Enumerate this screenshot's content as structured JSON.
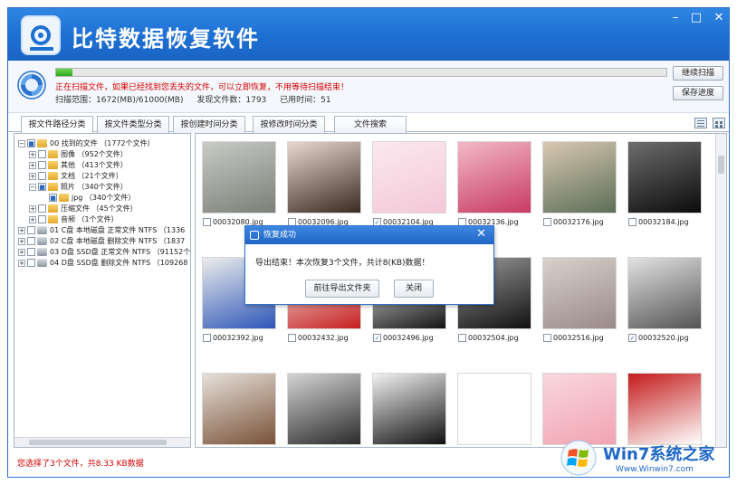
{
  "app": {
    "title": "比特数据恢复软件"
  },
  "window_controls": {
    "minimize": "–",
    "maximize": "□",
    "close": "✕"
  },
  "scan": {
    "progress": 0.027,
    "message": "正在扫描文件，如果已经找到您丢失的文件，可以立即恢复，不用等待扫描结束！",
    "range": "扫描范围：1672(MB)/61000(MB)",
    "found": "发现文件数：1793",
    "elapsed": "已用时间：51",
    "continue_btn": "继续扫描",
    "save_btn": "保存进度"
  },
  "tabs": [
    "按文件路径分类",
    "按文件类型分类",
    "按创建时间分类",
    "按修改时间分类",
    "文件搜索"
  ],
  "tree": [
    {
      "label": "00 找到的文件  （1772个文件）",
      "indent": 0,
      "toggle": "−",
      "checked": "partial",
      "icon": "folder"
    },
    {
      "label": "图像    （952个文件）",
      "indent": 1,
      "toggle": "+",
      "checked": false,
      "icon": "folder"
    },
    {
      "label": "其他    （413个文件）",
      "indent": 1,
      "toggle": "+",
      "checked": false,
      "icon": "folder"
    },
    {
      "label": "文档    （21个文件）",
      "indent": 1,
      "toggle": "+",
      "checked": false,
      "icon": "folder"
    },
    {
      "label": "照片    （340个文件）",
      "indent": 1,
      "toggle": "−",
      "checked": "partial",
      "icon": "folder"
    },
    {
      "label": "jpg   （340个文件）",
      "indent": 2,
      "toggle": "",
      "checked": "partial",
      "icon": "folder"
    },
    {
      "label": "压缩文件   （45个文件）",
      "indent": 1,
      "toggle": "+",
      "checked": false,
      "icon": "folder"
    },
    {
      "label": "音频    （1个文件）",
      "indent": 1,
      "toggle": "+",
      "checked": false,
      "icon": "folder"
    },
    {
      "label": "01 C盘 本地磁盘 正常文件 NTFS  （1336",
      "indent": 0,
      "toggle": "+",
      "checked": false,
      "icon": "drive"
    },
    {
      "label": "02 C盘 本地磁盘 删除文件 NTFS  （1837",
      "indent": 0,
      "toggle": "+",
      "checked": false,
      "icon": "drive"
    },
    {
      "label": "03 D盘 SSD盘 正常文件 NTFS  （91152个",
      "indent": 0,
      "toggle": "+",
      "checked": false,
      "icon": "drive"
    },
    {
      "label": "04 D盘 SSD盘 删除文件 NTFS  （109268",
      "indent": 0,
      "toggle": "+",
      "checked": false,
      "icon": "drive"
    }
  ],
  "thumbnails": [
    {
      "name": "00032080.jpg",
      "checked": false,
      "bg": "#7a7f78",
      "bg2": "#c9cbc5"
    },
    {
      "name": "00032096.jpg",
      "checked": false,
      "bg": "#3b2a22",
      "bg2": "#e9d8cf"
    },
    {
      "name": "00032104.jpg",
      "checked": true,
      "bg": "#f4c7d8",
      "bg2": "#fbe9ef"
    },
    {
      "name": "00032136.jpg",
      "checked": false,
      "bg": "#c83a63",
      "bg2": "#f2b9c6"
    },
    {
      "name": "00032176.jpg",
      "checked": false,
      "bg": "#5b6e57",
      "bg2": "#d9c8b2"
    },
    {
      "name": "00032184.jpg",
      "checked": false,
      "bg": "#0b0b0b",
      "bg2": "#6d6d6d"
    },
    {
      "name": "00032392.jpg",
      "checked": false,
      "bg": "#2d56b8",
      "bg2": "#ececec"
    },
    {
      "name": "00032432.jpg",
      "checked": false,
      "bg": "#c81f1f",
      "bg2": "#f2f2f2"
    },
    {
      "name": "00032496.jpg",
      "checked": true,
      "bg": "#141414",
      "bg2": "#f4f4f4"
    },
    {
      "name": "00032504.jpg",
      "checked": false,
      "bg": "#111111",
      "bg2": "#9a9a9a"
    },
    {
      "name": "00032516.jpg",
      "checked": false,
      "bg": "#9a8a87",
      "bg2": "#d9d1cc"
    },
    {
      "name": "00032520.jpg",
      "checked": true,
      "bg": "#545454",
      "bg2": "#e2e2e2"
    },
    {
      "name": "",
      "checked": false,
      "bg": "#7a5238",
      "bg2": "#e6e0da"
    },
    {
      "name": "",
      "checked": false,
      "bg": "#2b2b2b",
      "bg2": "#d4d4d4"
    },
    {
      "name": "",
      "checked": false,
      "bg": "#111111",
      "bg2": "#f2f2f2"
    },
    {
      "name": "",
      "checked": false,
      "bg": "#ffffff",
      "bg2": "#ffffff"
    },
    {
      "name": "",
      "checked": false,
      "bg": "#f1a3b2",
      "bg2": "#f9d7de"
    },
    {
      "name": "",
      "checked": false,
      "bg": "#ffffff",
      "bg2": "#c41b1b"
    }
  ],
  "status_bar": {
    "selection": "您选择了3个文件，共8.33 KB数据"
  },
  "dialog": {
    "title": "恢复成功",
    "message": "导出结束！本次恢复3个文件，共计8(KB)数据！",
    "open_btn": "前往导出文件夹",
    "close_btn": "关闭",
    "close_icon": "✕"
  },
  "watermark": {
    "title": "Win7系统之家",
    "url": "Www.Winwin7.com"
  },
  "colors": {
    "title_bar": "#1d6fd2",
    "alert_text": "#d40000",
    "progress": "#2fa61e"
  }
}
